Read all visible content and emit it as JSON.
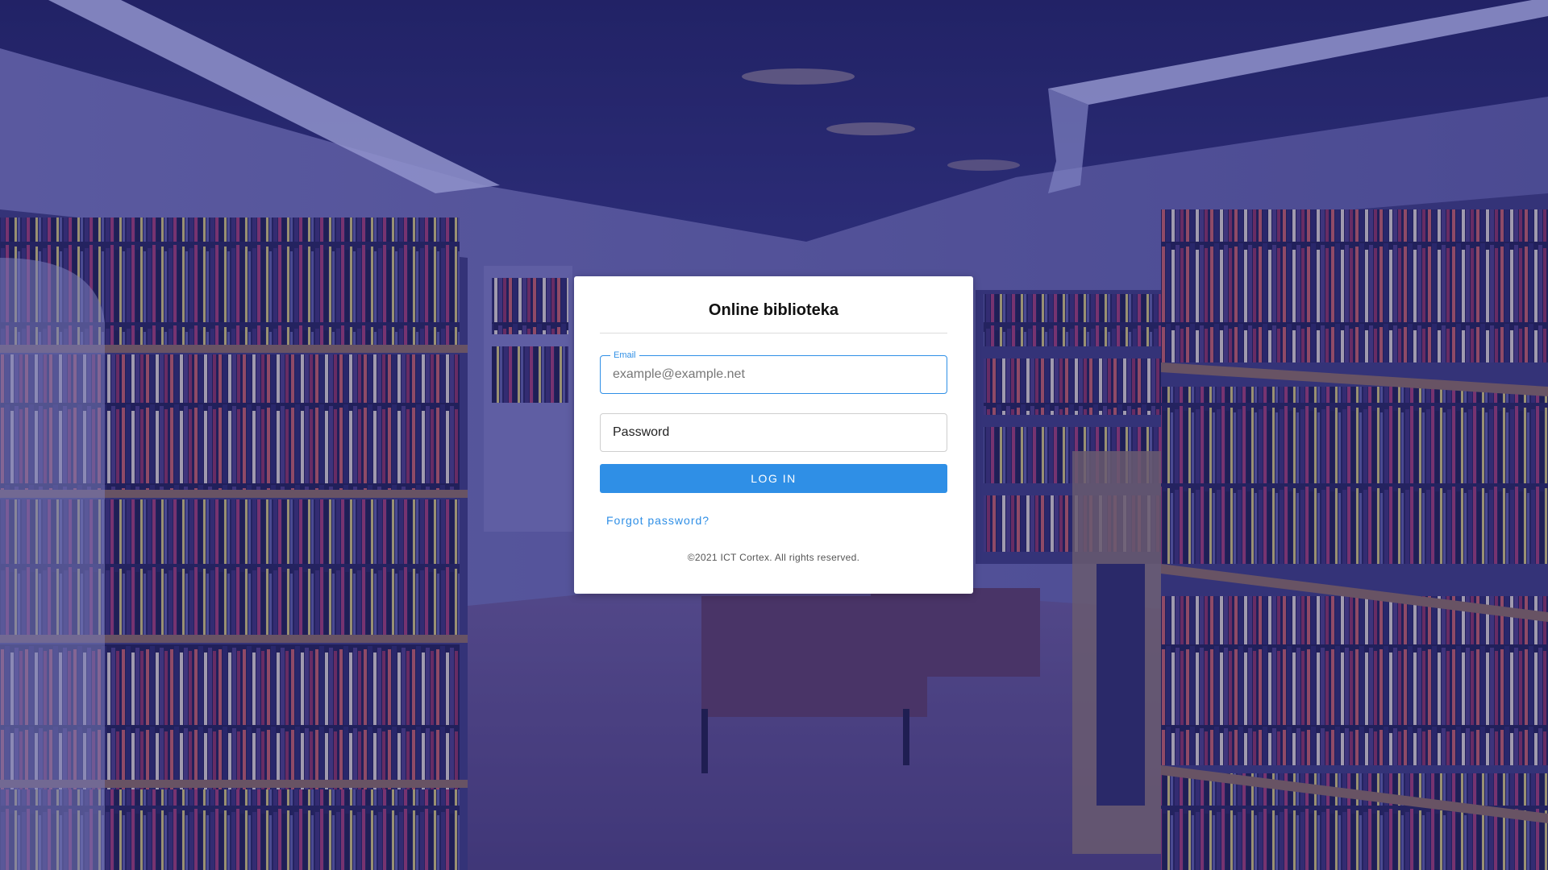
{
  "login": {
    "title": "Online biblioteka",
    "email": {
      "label": "Email",
      "placeholder": "example@example.net",
      "value": ""
    },
    "password": {
      "placeholder": "Password",
      "value": ""
    },
    "submit_label": "LOG IN",
    "forgot_label": "Forgot password?",
    "footer": "©2021 ICT Cortex. All rights reserved."
  },
  "colors": {
    "accent": "#2f8fe6",
    "overlay": "#28287f"
  }
}
